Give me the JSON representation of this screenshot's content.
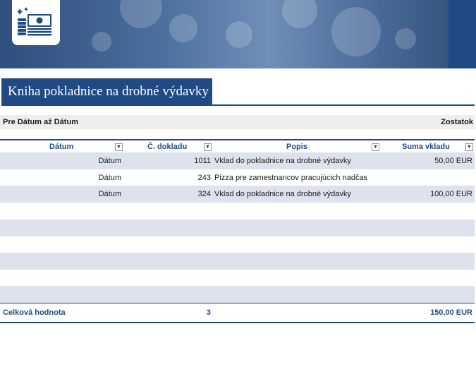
{
  "document": {
    "title": "Kniha pokladnice na drobné výdavky",
    "period_label": "Pre Dátum až Dátum",
    "balance_label": "Zostatok"
  },
  "logo": {
    "icon": "money-stack-icon"
  },
  "table": {
    "headers": [
      "Dátum",
      "Č. dokladu",
      "Popis",
      "Suma vkladu"
    ],
    "rows": [
      {
        "date": "Dátum",
        "doc": "1011",
        "desc": "Vklad do pokladnice na drobné výdavky",
        "amount": "50,00 EUR"
      },
      {
        "date": "Dátum",
        "doc": "243",
        "desc": "Pizza pre zamestnancov pracujúcich nadčas",
        "amount": ""
      },
      {
        "date": "Dátum",
        "doc": "324",
        "desc": "Vklad do pokladnice na drobné výdavky",
        "amount": "100,00 EUR"
      }
    ],
    "total": {
      "label": "Celková hodnota",
      "count": "3",
      "sum": "150,00 EUR"
    }
  },
  "colors": {
    "accent": "#1f4a84",
    "band": "#dde2ec"
  }
}
